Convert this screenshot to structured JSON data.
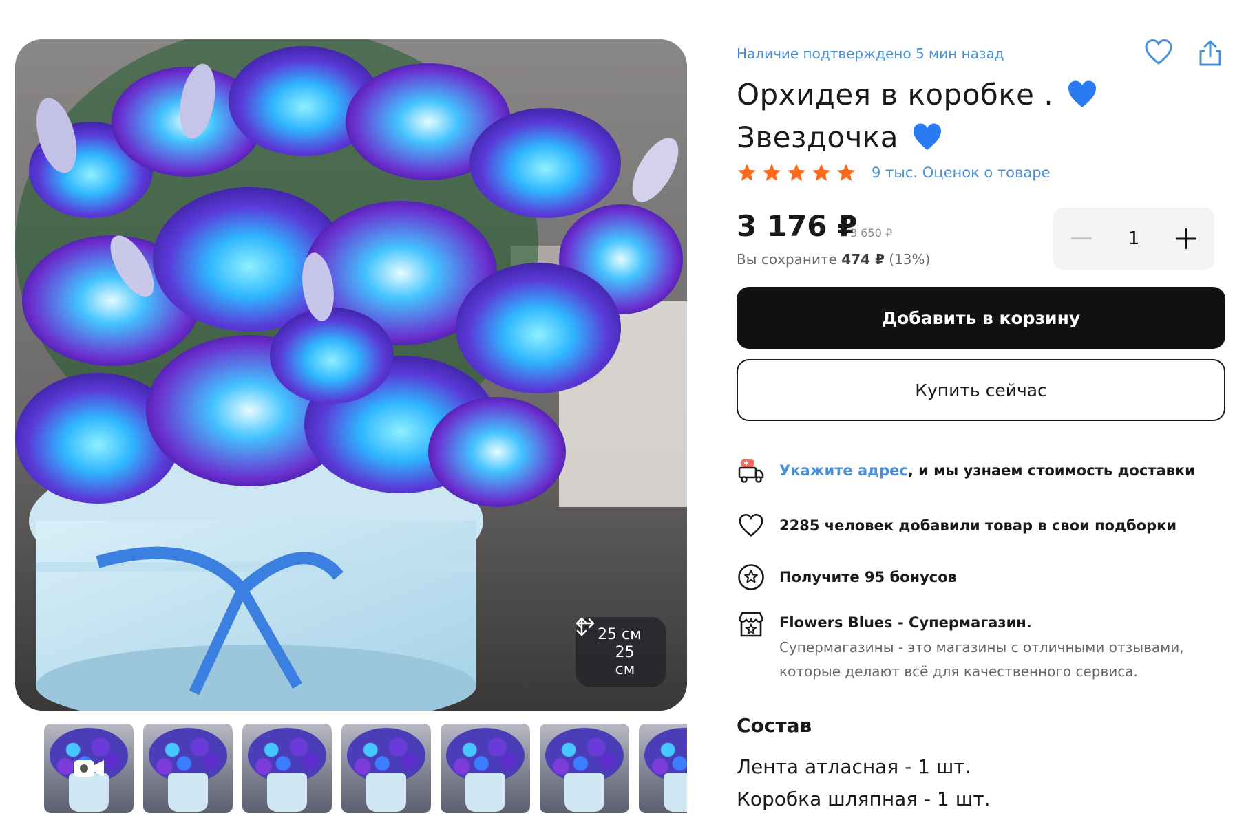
{
  "product": {
    "availability": "Наличие подтверждено 5 мин назад",
    "title_line1": "Орхидея в коробке .",
    "title_line2": "Звездочка",
    "rating_text": "9 тыс. Оценок о товаре",
    "rating_stars": 5,
    "price": "3 176 ₽",
    "old_price": "3 650 ₽",
    "savings_prefix": "Вы сохраните",
    "savings_amount": "474 ₽",
    "savings_percent": "(13%)",
    "quantity": "1",
    "add_to_cart": "Добавить в корзину",
    "buy_now": "Купить сейчас"
  },
  "photo": {
    "width_label": "25 см",
    "height_label": "25 см",
    "thumbnail_count": 7
  },
  "features": {
    "delivery_link": "Укажите адрес",
    "delivery_text": ", и мы узнаем стоимость доставки",
    "collections": "2285 человек добавили товар в свои подборки",
    "bonus": "Получите 95 бонусов",
    "store_name": "Flowers Blues - Супермагазин.",
    "store_desc": "Супермагазины - это магазины с отличными отзывами, которые делают всё для качественного сервиса."
  },
  "composition": {
    "title": "Состав",
    "items": [
      "Лента атласная - 1 шт.",
      "Коробка шляпная - 1 шт."
    ]
  },
  "colors": {
    "accent_link": "#4a90d9",
    "star": "#ff6a1a",
    "primary_button": "#111111"
  },
  "icons": [
    "heart-icon",
    "share-icon",
    "star-icon",
    "minus-icon",
    "plus-icon",
    "delivery-truck-icon",
    "heart-outline-icon",
    "bonus-star-icon",
    "store-icon",
    "width-arrow-icon",
    "height-arrow-icon",
    "video-camera-icon"
  ]
}
